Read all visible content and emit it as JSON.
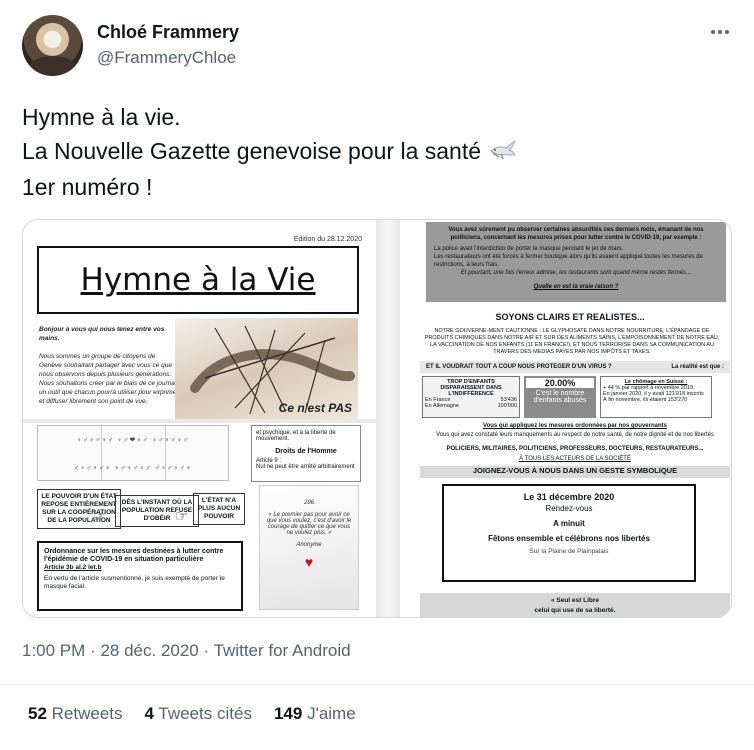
{
  "author": {
    "name": "Chloé Frammery",
    "handle": "@FrammeryChloe"
  },
  "tweet": {
    "line1": "Hymne à la vie.",
    "line2": "La Nouvelle Gazette genevoise pour la santé",
    "line3": "1er numéro !"
  },
  "media": {
    "edition": "Edition du 28.12.2020",
    "title": "Hymne à la Vie",
    "intro_bold": "Bonjour à vous qui nous tenez entre vos mains.",
    "intro_body": "Nous sommes un groupe de citoyens de Genève souhaitant partager avec vous ce que nous observons depuis plusieurs générations. Nous souhaitons créer par le biais de ce journal un outil que chacun pourra utiliser pour exprimer et diffuser librement son point de vue.",
    "hands_caption": "Ce n'est PAS",
    "droits_top": "et psychique, et à la liberté de mouvement.",
    "droits_title": "Droits de l'Homme",
    "droits_article": "Article 9 :",
    "droits_text": "Nul ne peut être arrêté arbitrairement",
    "slogan1": "LE POUVOIR D'UN ÉTAT REPOSE ENTIÈREMENT SUR LA COOPÉRATION DE LA POPULATION",
    "slogan2": "DÈS L'INSTANT OÙ LA POPULATION REFUSE D'OBÉIR",
    "slogan3": "L'ÉTAT N'A PLUS AUCUN POUVOIR",
    "ord_title": "Ordonnance sur les mesures destinées à lutter contre l'épidémie de COVID-19 en situation particulière",
    "ord_article": "Article 3b al.2 let.b",
    "ord_text": "En vertu de l'article susmentionné, je suis exempté de porter le masque facial.",
    "book_number": "296",
    "book_text": "« Le premier pas pour avoir ce que vous voulez, c'est d'avoir le courage de quitter ce que vous ne voulez plus. »",
    "book_author": "Anonyme",
    "gray_intro": "Vous avez sûrement pu observer certaines absurdités ces derniers mois, émanant de nos politiciens, concernant les mesures prises pour lutter contre le COVID-19, par exemple :",
    "gray_b1": "La police avait l'interdiction de porter le masque pendant le jet de mars.",
    "gray_b2": "Les restaurateurs ont été forcés à fermer boutique alors qu'ils avaient appliqué toutes les mesures de restrictions, à leurs frais.",
    "gray_b3": "Et pourtant, une fois l'erreur admise, les restaurants sont quand même restés fermés...",
    "gray_question": "Quelle en est la vraie raison ?",
    "soyons": "SOYONS CLAIRS ET REALISTES...",
    "para_right": "NOTRE GOUVERNE-MENT CAUTIONNE : LE GLYPHOSATE DANS NOTRE NOURRITURE, L'ÉPANDAGE DE PRODUITS CHIMIQUES DANS NOTRE AIR ET SUR DES ALIMENTS SAINS, L'EMPOISONNEMENT DE NOTRE EAU, LA VACCINATION DE NOS ENFANTS (11 EN FRANCE!), ET NOUS TERRORISE DANS SA COMMUNICATION AU TRAVERS DES MEDIAS PAYÉS PAR NOS IMPÔTS ET TAXES.",
    "strip_left": "ET IL VOUDRAIT TOUT A COUP NOUS PROTEGER D'UN VIRUS ?",
    "strip_right": "La réalité est que :",
    "stat_left_title": "TROP D'ENFANTS DISPARAISSENT DANS L'INDIFFÉRENCE",
    "stat_left_fr": "En France",
    "stat_left_fr_val": "53'436",
    "stat_left_de": "En Allemagne",
    "stat_left_de_val": "100'000",
    "stat_mid_pct": "20.00%",
    "stat_mid_text": "C'est le nombre d'enfants abusés",
    "stat_right_title": "Le chômage en Suisse :",
    "stat_right_l1": "+ 44 % par rapport à novembre 2019",
    "stat_right_l2": "En janvier 2020, il y avait 121'018 inscrits",
    "stat_right_l3": "À fin novembre, ils étaient 153'270",
    "r_line1": "Vous qui appliquez les mesures ordonnées par nos gouvernants",
    "r_line2": "Vous qui avez constaté leurs manquements au respect de notre santé, de notre dignité et de nos libertés",
    "r_line3": "POLICIERS, MILITAIRES, POLITICIENS, PROFESSEURS, DOCTEURS, RESTAURATEURS...",
    "r_line4": "À TOUS LES ACTEURS DE LA SOCIÉTÉ",
    "r_bar": "JOIGNEZ-VOUS À NOUS DANS UN GESTE SYMBOLIQUE",
    "event_date": "Le 31 décembre 2020",
    "event_rdv": "Rendez-vous",
    "event_time": "A minuit",
    "event_call": "Fêtons ensemble et célébrons nos libertés",
    "event_place": "Sur la Plaine de Plainpalais",
    "footer1": "« Seul est Libre",
    "footer2": "celui qui use de sa liberté."
  },
  "meta": {
    "time": "1:00 PM",
    "date": "28 déc. 2020",
    "source": "Twitter for Android",
    "sep": "·"
  },
  "stats": {
    "retweets_count": "52",
    "retweets_label": "Retweets",
    "quotes_count": "4",
    "quotes_label": "Tweets cités",
    "likes_count": "149",
    "likes_label": "J'aime"
  }
}
